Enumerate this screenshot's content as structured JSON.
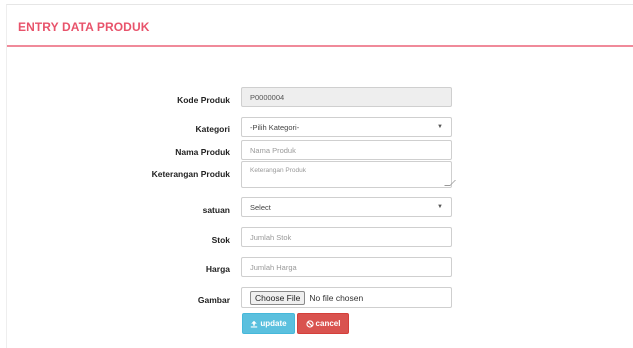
{
  "header": {
    "title": "ENTRY DATA PRODUK"
  },
  "form": {
    "kode_label": "Kode Produk",
    "kode_value": "P0000004",
    "kategori_label": "Kategori",
    "kategori_value": "-Pilih Kategori-",
    "nama_label": "Nama Produk",
    "nama_placeholder": "Nama Produk",
    "keterangan_label": "Keterangan Produk",
    "keterangan_placeholder": "Keterangan Produk",
    "satuan_label": "satuan",
    "satuan_value": "Select",
    "stok_label": "Stok",
    "stok_placeholder": "Jumlah Stok",
    "harga_label": "Harga",
    "harga_placeholder": "Jumlah Harga",
    "gambar_label": "Gambar",
    "file_button": "Choose File",
    "file_status": "No file chosen"
  },
  "actions": {
    "update_label": "update",
    "cancel_label": "cancel"
  },
  "colors": {
    "title": "#e8536b",
    "update": "#5bc0de",
    "cancel": "#d9534f"
  }
}
